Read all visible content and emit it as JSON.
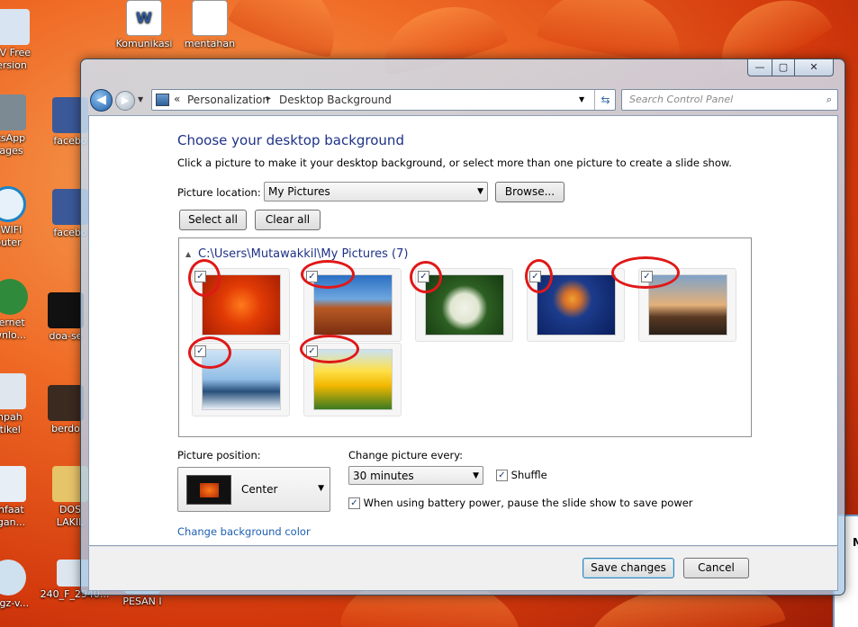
{
  "desktop": {
    "icons": [
      {
        "label": "CV Free\nersion"
      },
      {
        "label": "atsApp\nnages"
      },
      {
        "label": ", WIFI\nouter"
      },
      {
        "label": "ternet\nwnlo..."
      },
      {
        "label": "mpah\nrtikel"
      },
      {
        "label": "anfaat\nngan..."
      },
      {
        "label": "nagz-v..."
      },
      {
        "label": "Komunikasi"
      },
      {
        "label": "mentahan"
      },
      {
        "label": "facebo"
      },
      {
        "label": "facebo"
      },
      {
        "label": "doa-se"
      },
      {
        "label": "berdo"
      },
      {
        "label": "DOS\nLAKIL"
      },
      {
        "label": "240_F_2940..."
      },
      {
        "label": "PESAN I"
      }
    ]
  },
  "window": {
    "caption_buttons": {
      "minimize": "—",
      "maximize": "▢",
      "close": "✕"
    },
    "breadcrumb": [
      "«",
      "Personalization",
      "▸",
      "Desktop Background"
    ],
    "search_placeholder": "Search Control Panel"
  },
  "main": {
    "title": "Choose your desktop background",
    "description": "Click a picture to make it your desktop background, or select more than one picture to create a slide show.",
    "picture_location_label": "Picture location:",
    "picture_location_value": "My Pictures",
    "browse_label": "Browse...",
    "select_all_label": "Select all",
    "clear_all_label": "Clear all",
    "group_header": "C:\\Users\\Mutawakkil\\My Pictures (7)",
    "pictures": [
      {
        "name": "flower",
        "checked": true
      },
      {
        "name": "desert",
        "checked": true
      },
      {
        "name": "hydrangea",
        "checked": true
      },
      {
        "name": "jellyfish",
        "checked": true
      },
      {
        "name": "lighthouse",
        "checked": true
      },
      {
        "name": "penguins",
        "checked": true
      },
      {
        "name": "tulips",
        "checked": true
      }
    ],
    "picture_position_label": "Picture position:",
    "picture_position_value": "Center",
    "change_every_label": "Change picture every:",
    "change_every_value": "30 minutes",
    "shuffle_label": "Shuffle",
    "battery_label": "When using battery power, pause the slide show to save power",
    "change_color_link": "Change background color"
  },
  "footer": {
    "save_label": "Save changes",
    "cancel_label": "Cancel"
  },
  "taskbar_hint": {
    "text": "M"
  }
}
